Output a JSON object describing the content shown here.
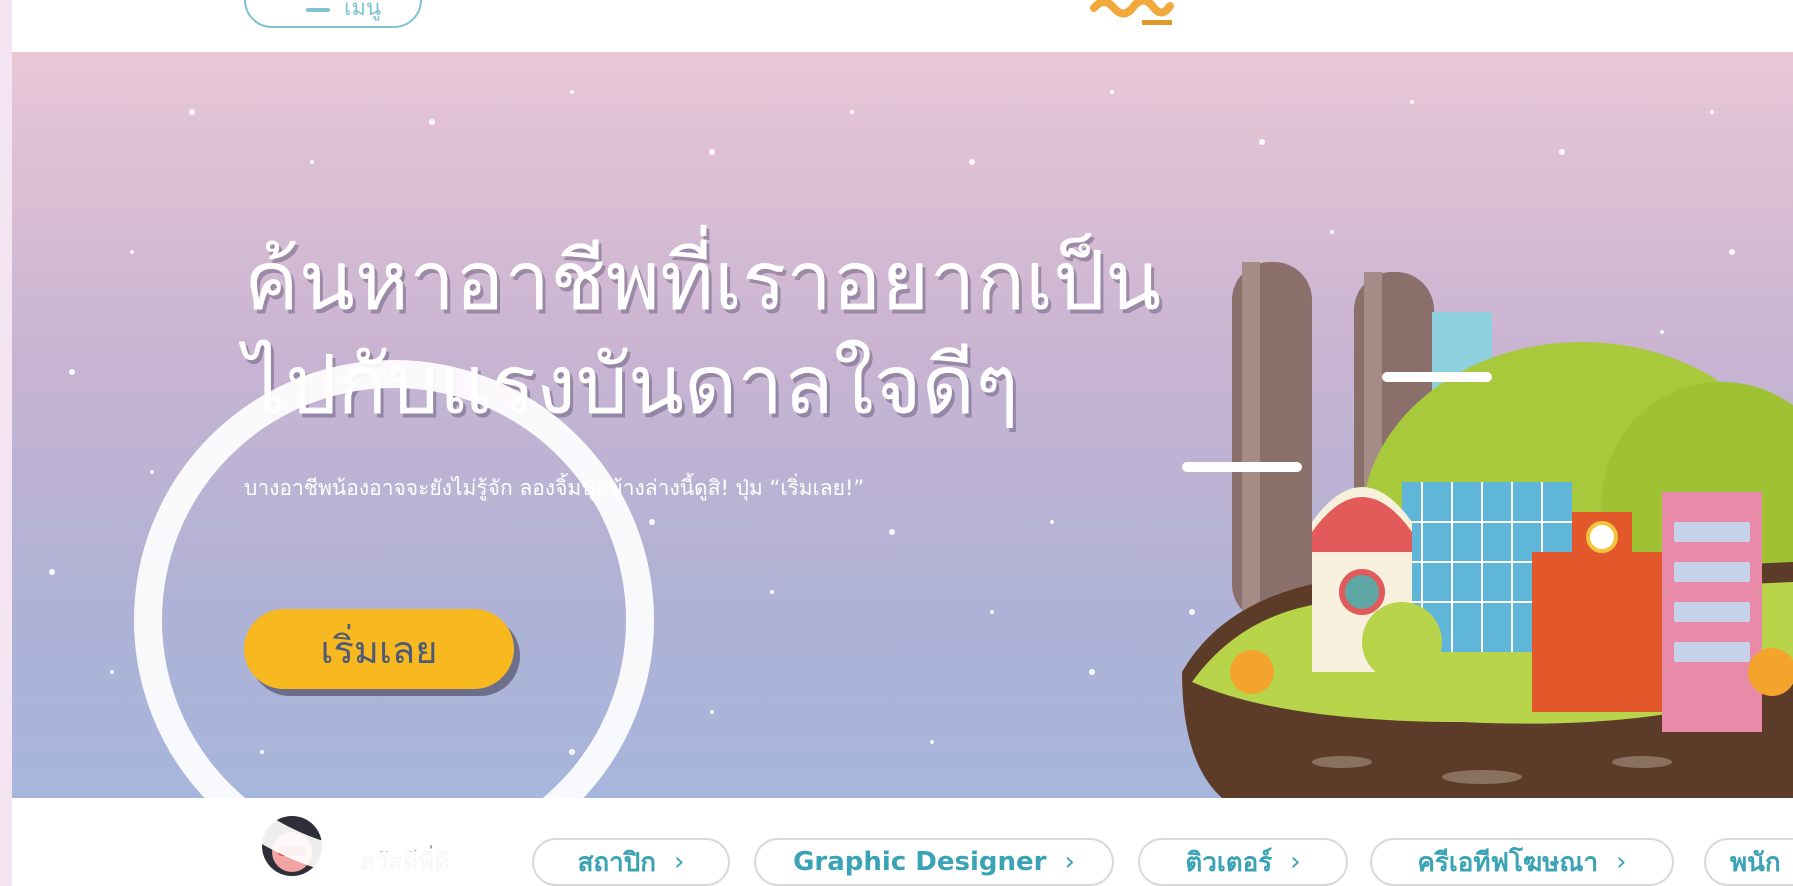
{
  "header": {
    "menu_label": "เมนู"
  },
  "hero": {
    "headline_line1": "ค้นหาอาชีพที่เราอยากเป็น",
    "headline_line2": "ไปกับแรงบันดาลใจดีๆ",
    "subtitle": "บางอาชีพน้องอาจจะยังไม่รู้จัก ลองจิ้มปุ่มข้างล่างนี้ดูสิ! ปุ่ม “เริ่มเลย!”",
    "start_button": "เริ่มเลย"
  },
  "bottom": {
    "greeting": "สวัสดีพี่ดี",
    "chips": [
      {
        "label": "สถาปิก",
        "chevron": "›"
      },
      {
        "label": "Graphic Designer",
        "chevron": "›"
      },
      {
        "label": "ติวเตอร์",
        "chevron": "›"
      },
      {
        "label": "ครีเอทีฟโฆษณา",
        "chevron": "›"
      },
      {
        "label": "พนัก",
        "chevron": ""
      }
    ]
  },
  "colors": {
    "accent_teal": "#3aa3b5",
    "button_yellow": "#f7b91f"
  }
}
